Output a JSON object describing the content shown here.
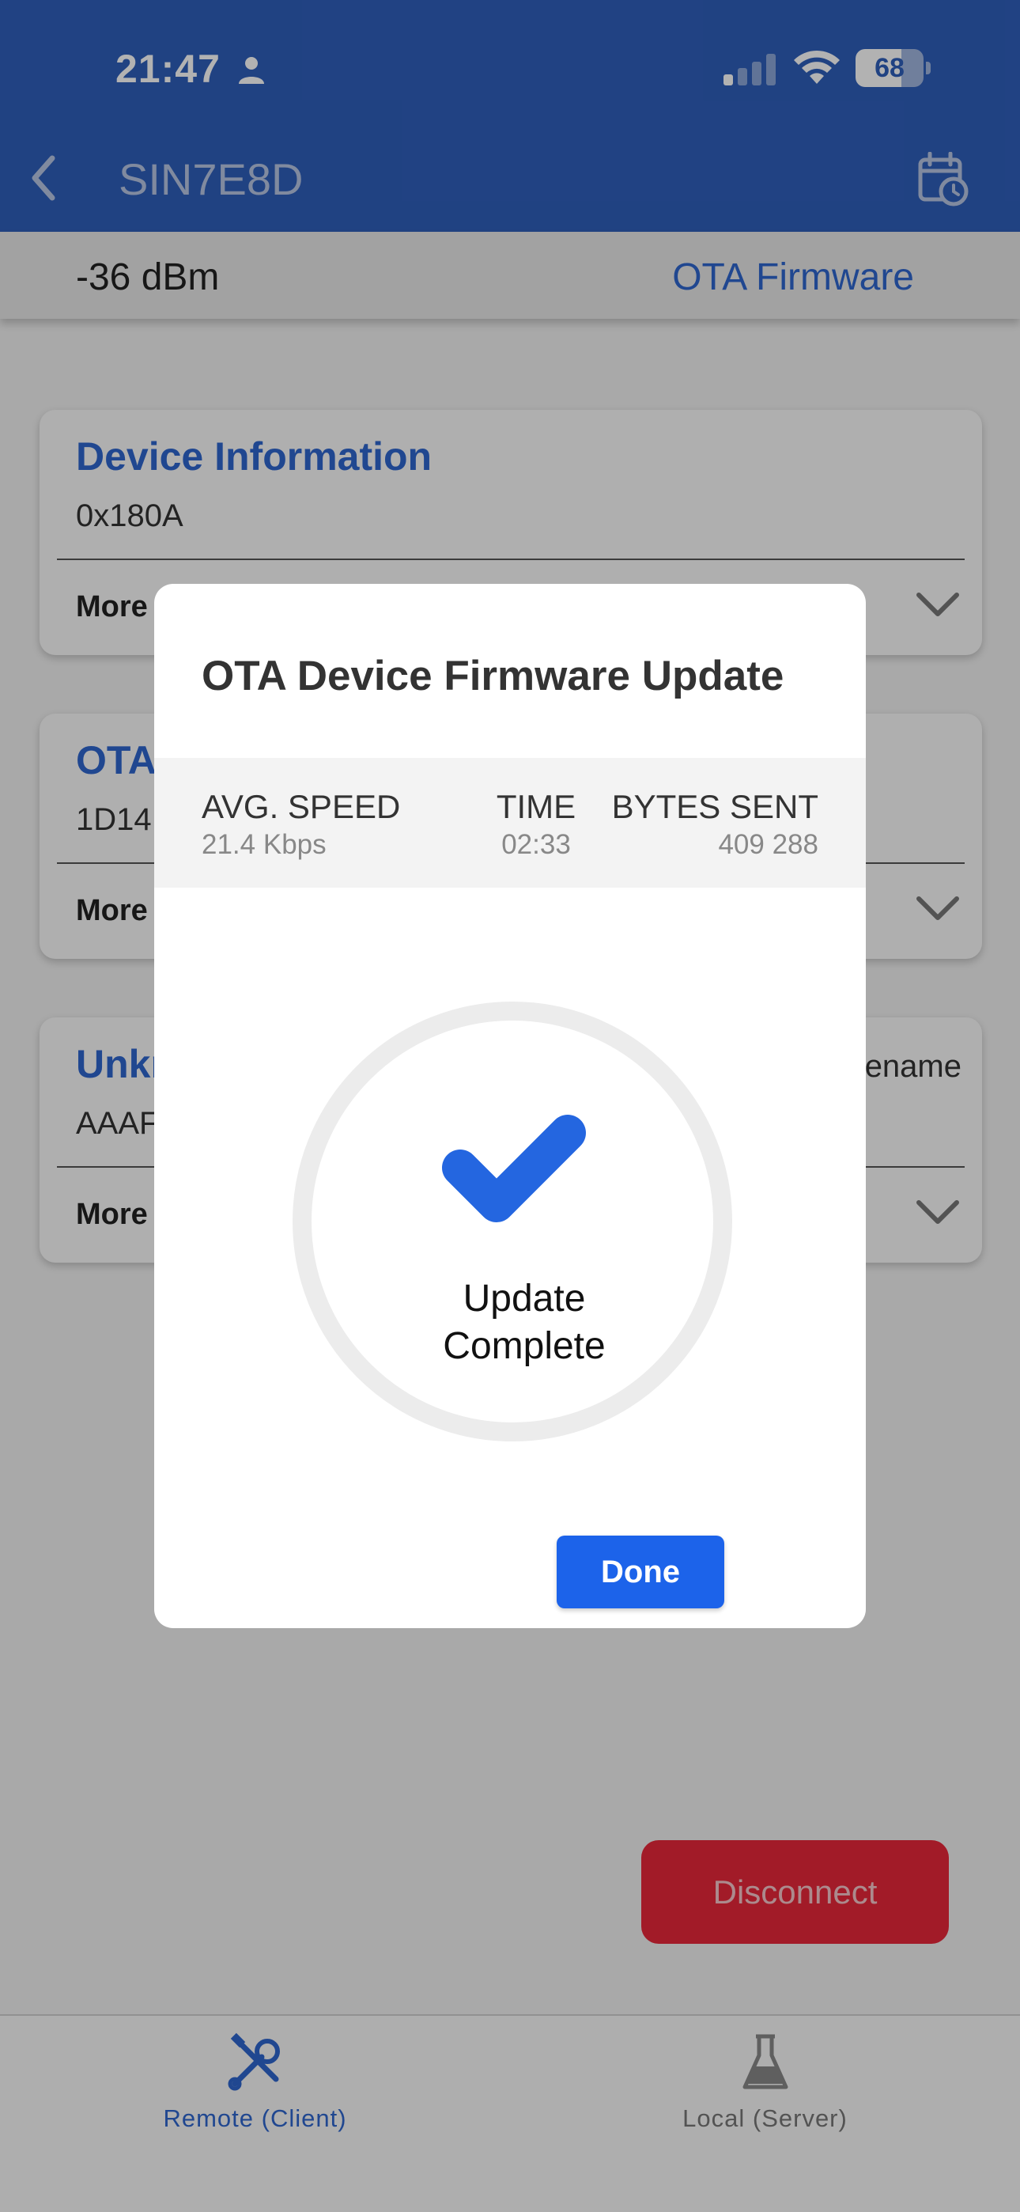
{
  "status_bar": {
    "time": "21:47",
    "battery": "68",
    "battery_level": 0.68,
    "icons": [
      "person-icon",
      "signal-icon",
      "wifi-icon",
      "battery-icon"
    ]
  },
  "nav": {
    "title": "SIN7E8D",
    "back_icon": "chevron-left-icon",
    "action_icon": "calendar-clock-icon"
  },
  "subbar": {
    "rssi": "-36 dBm",
    "ota_link": "OTA Firmware"
  },
  "services": [
    {
      "title": "Device Information",
      "uuid": "0x180A",
      "more": "More",
      "action": ""
    },
    {
      "title": "OTA",
      "uuid": "1D14",
      "more": "More",
      "action": ""
    },
    {
      "title": "Unkr",
      "uuid": "AAAF",
      "more": "More",
      "action": "ename"
    }
  ],
  "disconnect_label": "Disconnect",
  "tabs": [
    {
      "label": "Remote (Client)",
      "icon": "tools-icon",
      "active": true
    },
    {
      "label": "Local (Server)",
      "icon": "flask-icon",
      "active": false
    }
  ],
  "dialog": {
    "title": "OTA Device Firmware Update",
    "stats": {
      "speed_label": "AVG. SPEED",
      "speed_value": "21.4 Kbps",
      "time_label": "TIME",
      "time_value": "02:33",
      "bytes_label": "BYTES SENT",
      "bytes_value": "409 288"
    },
    "status_line1": "Update",
    "status_line2": "Complete",
    "done_label": "Done"
  },
  "colors": {
    "brand_blue": "#2f5fbb",
    "link_blue": "#2f66cf",
    "button_blue": "#1c63ea",
    "check_blue": "#2466e0",
    "disconnect_red": "#e8283a"
  }
}
